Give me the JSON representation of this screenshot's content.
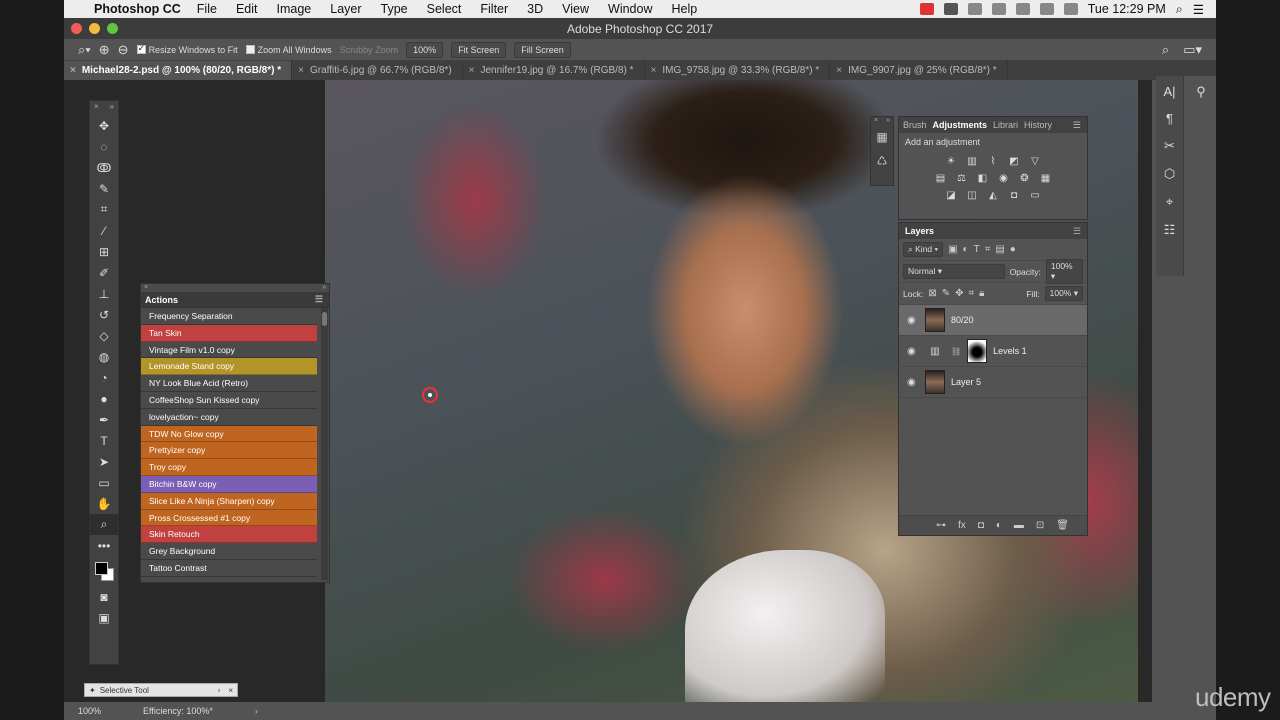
{
  "menubar": {
    "app": "Photoshop CC",
    "items": [
      "File",
      "Edit",
      "Image",
      "Layer",
      "Type",
      "Select",
      "Filter",
      "3D",
      "View",
      "Window",
      "Help"
    ],
    "clock": "Tue 12:29 PM"
  },
  "window": {
    "title": "Adobe Photoshop CC 2017"
  },
  "options": {
    "resize_windows": "Resize Windows to Fit",
    "zoom_all": "Zoom All Windows",
    "scrubby": "Scrubby Zoom",
    "zoom_value": "100%",
    "fit_screen": "Fit Screen",
    "fill_screen": "Fill Screen"
  },
  "tabs": [
    {
      "label": "Michael28-2.psd @ 100% (80/20, RGB/8*) *",
      "active": true
    },
    {
      "label": "Graffiti-6.jpg @ 66.7% (RGB/8*)"
    },
    {
      "label": "Jennifer19.jpg @ 16.7% (RGB/8) *"
    },
    {
      "label": "IMG_9758.jpg @ 33.3% (RGB/8*) *"
    },
    {
      "label": "IMG_9907.jpg @ 25% (RGB/8*) *"
    }
  ],
  "actions": {
    "title": "Actions",
    "items": [
      {
        "label": "Frequency Separation",
        "color": "#4a4a4a"
      },
      {
        "label": "Tan Skin",
        "color": "#c0413f"
      },
      {
        "label": "Vintage Film v1.0 copy",
        "color": "#4a4a4a"
      },
      {
        "label": "Lemonade Stand copy",
        "color": "#b39428"
      },
      {
        "label": "NY Look Blue Acid (Retro)",
        "color": "#4a4a4a"
      },
      {
        "label": "CoffeeShop Sun Kissed copy",
        "color": "#4a4a4a"
      },
      {
        "label": "lovelyaction~ copy",
        "color": "#4a4a4a"
      },
      {
        "label": "TDW No Glow copy",
        "color": "#c0651f"
      },
      {
        "label": "Prettyizer copy",
        "color": "#c0651f"
      },
      {
        "label": "Troy copy",
        "color": "#c0651f"
      },
      {
        "label": "Bitchin B&W copy",
        "color": "#7b5fb5"
      },
      {
        "label": "Slice Like A Ninja (Sharpen) copy",
        "color": "#c0651f"
      },
      {
        "label": "Pross Crossessed #1 copy",
        "color": "#c0651f"
      },
      {
        "label": "Skin Retouch",
        "color": "#c0413f"
      },
      {
        "label": "Grey Background",
        "color": "#4a4a4a"
      },
      {
        "label": "Tattoo Contrast",
        "color": "#4a4a4a"
      }
    ]
  },
  "adjustments": {
    "tabs": [
      "Brush",
      "Adjustments",
      "Librari",
      "History"
    ],
    "subtitle": "Add an adjustment"
  },
  "layers": {
    "title": "Layers",
    "filter": "Kind",
    "blend_mode": "Normal",
    "opacity_label": "Opacity:",
    "opacity": "100%",
    "lock_label": "Lock:",
    "fill_label": "Fill:",
    "fill": "100%",
    "items": [
      {
        "name": "80/20",
        "selected": true
      },
      {
        "name": "Levels 1"
      },
      {
        "name": "Layer 5"
      }
    ]
  },
  "status": {
    "zoom": "100%",
    "info": "Efficiency: 100%*"
  },
  "selective_tool": "Selective Tool",
  "watermark": "udemy"
}
